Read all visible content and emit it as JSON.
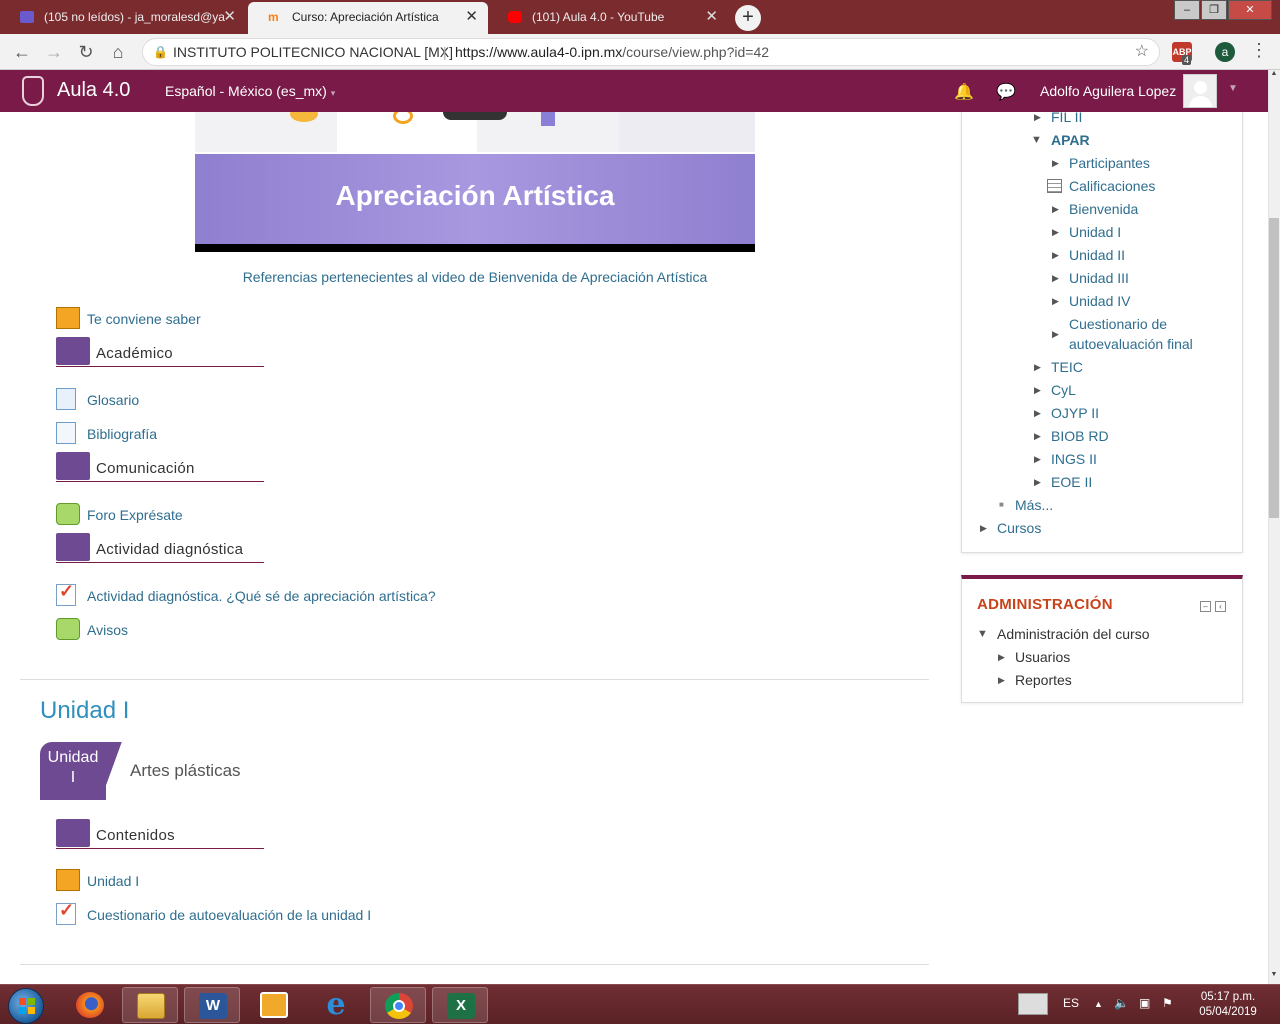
{
  "browser": {
    "tabs": [
      {
        "title": "(105 no leídos) - ja_moralesd@ya",
        "favicon_color": "#6a5acd"
      },
      {
        "title": "Curso: Apreciación Artística",
        "favicon_color": "#f98012"
      },
      {
        "title": "(101) Aula 4.0 - YouTube",
        "favicon_color": "#ff0000"
      }
    ],
    "new_tab": "+",
    "site_name": "INSTITUTO POLITECNICO NACIONAL [MX]",
    "url_host": "https://www.aula4-0.ipn.mx",
    "url_path": "/course/view.php?id=42",
    "abp_count": "4",
    "profile_initial": "a"
  },
  "navbar": {
    "site_title": "Aula 4.0",
    "language": "Español - México (es_mx)",
    "user_name": "Adolfo Aguilera Lopez",
    "bg_color": "#7a1a48"
  },
  "banner": {
    "title": "Apreciación Artística"
  },
  "main": {
    "caption_link": "Referencias pertenecientes al video de Bienvenida de Apreciación Artística",
    "items": {
      "te_conviene": "Te conviene saber",
      "academico": "Académico",
      "glosario": "Glosario",
      "bibliografia": "Bibliografía",
      "comunicacion": "Comunicación",
      "foro": "Foro Exprésate",
      "actividad_head": "Actividad diagnóstica",
      "actividad_link": "Actividad diagnóstica. ¿Qué sé de apreciación artística?",
      "avisos": "Avisos"
    },
    "unit": {
      "section_title": "Unidad I",
      "tab_line1": "Unidad",
      "tab_line2": "I",
      "subtitle": "Artes plásticas",
      "contenidos": "Contenidos",
      "unidad_link": "Unidad I",
      "cuestionario": "Cuestionario de autoevaluación de la unidad I"
    }
  },
  "navigation_block": {
    "items": {
      "fil": "FIL II",
      "apar": "APAR",
      "participantes": "Participantes",
      "calificaciones": "Calificaciones",
      "bienvenida": "Bienvenida",
      "unidad1": "Unidad I",
      "unidad2": "Unidad II",
      "unidad3": "Unidad III",
      "unidad4": "Unidad IV",
      "cuestionario_1": "Cuestionario de",
      "cuestionario_2": "autoevaluación final",
      "teic": "TEIC",
      "cyl": "CyL",
      "ojyp": "OJYP II",
      "biob": "BIOB RD",
      "ings": "INGS II",
      "eoe": "EOE II",
      "mas": "Más...",
      "cursos": "Cursos"
    }
  },
  "admin_block": {
    "title": "ADMINISTRACIÓN",
    "admin_course": "Administración del curso",
    "usuarios": "Usuarios",
    "reportes": "Reportes"
  },
  "taskbar": {
    "lang": "ES",
    "time": "05:17 p.m.",
    "date": "05/04/2019"
  }
}
